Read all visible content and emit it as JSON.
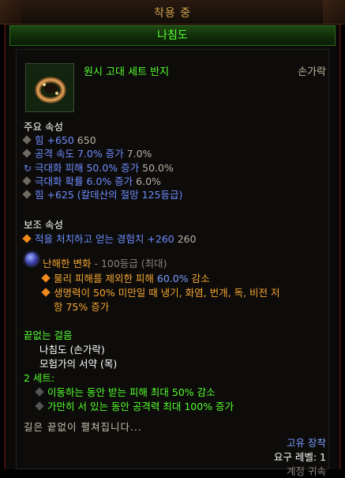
{
  "header": {
    "equipped_label": "착용 중",
    "item_name": "나침도"
  },
  "item": {
    "type_name": "원시 고대 세트 반지",
    "slot": "손가락",
    "icon": "ring-icon"
  },
  "primary": {
    "title": "주요 속성",
    "lines": [
      {
        "main": "힘 +650",
        "compare": "650"
      },
      {
        "main": "공격 속도 7.0% 증가",
        "compare": "7.0%"
      },
      {
        "main": "극대화 피해 50.0% 증가",
        "compare": "50.0%"
      },
      {
        "main": "극대화 확률 6.0% 증가",
        "compare": "6.0%"
      },
      {
        "main": "힘 +625 (칼데산의 절망 125등급)",
        "compare": ""
      }
    ]
  },
  "secondary": {
    "title": "보조 속성",
    "lines": [
      {
        "main": "적을 처치하고 얻는 경험치 +260",
        "compare": "260"
      }
    ]
  },
  "legendary_gem": {
    "name": "난해한 변화",
    "rank": "- 100등급 (최대)",
    "effects": [
      {
        "pre": "물리 피해를 제외한 피해 ",
        "value": "60.0%",
        "post": " 감소"
      },
      {
        "line1": "생명력이 50% 미만일 때 냉기, 화염, 번개, 독, 비전 저",
        "line2": "항 75% 증가"
      }
    ]
  },
  "set": {
    "name": "끝없는 걸음",
    "pieces": [
      "나침도 (손가락)",
      "모험가의 서약 (목)"
    ],
    "bonus_title": "2 세트:",
    "bonuses": [
      "이동하는 동안 받는 피해 최대 50% 감소",
      "가만히 서 있는 동안 공격력 최대 100% 증가"
    ]
  },
  "flavor": "길은 끝없이 펼쳐집니다...",
  "footer": {
    "unique_label": "고유 장착",
    "level_label": "요구 레벨: 1",
    "partial_label": "계정 귀속"
  },
  "colors": {
    "set_green": "#54ff2e",
    "magic_blue": "#6f8cff",
    "legendary_orange": "#f5a530",
    "equipped_gold": "#d0a44a"
  }
}
